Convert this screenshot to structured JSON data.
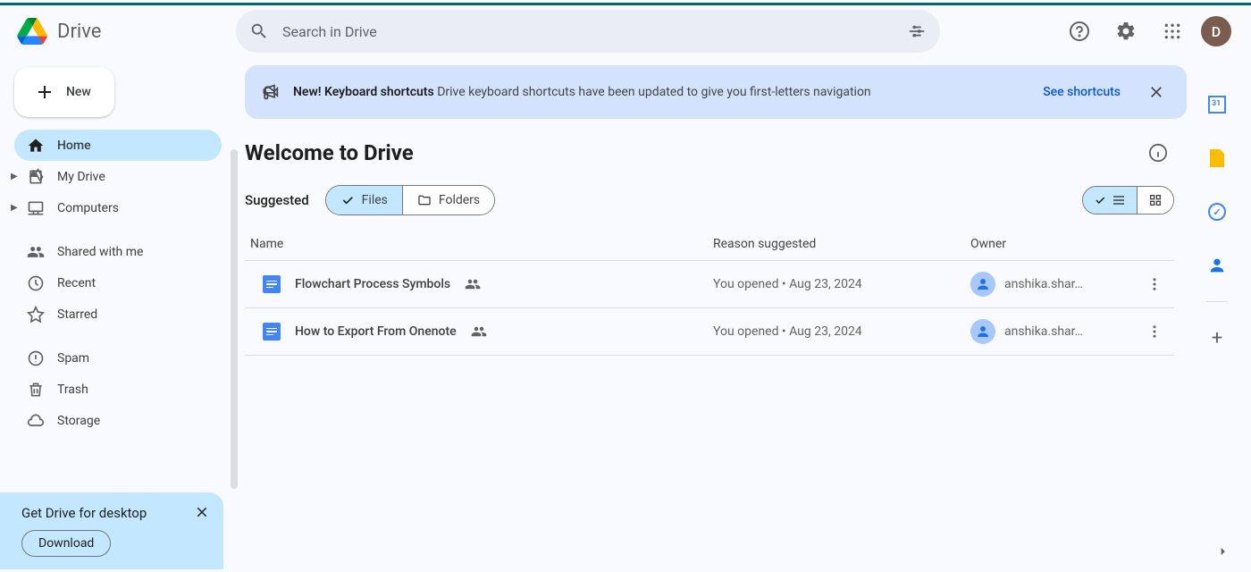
{
  "app": {
    "name": "Drive"
  },
  "search": {
    "placeholder": "Search in Drive"
  },
  "avatar_initial": "D",
  "new_button": "New",
  "sidebar": {
    "items": [
      {
        "label": "Home",
        "active": true
      },
      {
        "label": "My Drive",
        "expandable": true
      },
      {
        "label": "Computers",
        "expandable": true
      },
      {
        "label": "Shared with me"
      },
      {
        "label": "Recent"
      },
      {
        "label": "Starred"
      },
      {
        "label": "Spam"
      },
      {
        "label": "Trash"
      },
      {
        "label": "Storage"
      }
    ]
  },
  "promo": {
    "title": "Get Drive for desktop",
    "button": "Download"
  },
  "banner": {
    "bold": "New! Keyboard shortcuts",
    "text": " Drive keyboard shortcuts have been updated to give you first-letters navigation",
    "link": "See shortcuts"
  },
  "welcome": "Welcome to Drive",
  "suggested_label": "Suggested",
  "filters": {
    "files": "Files",
    "folders": "Folders"
  },
  "columns": {
    "name": "Name",
    "reason": "Reason suggested",
    "owner": "Owner"
  },
  "rows": [
    {
      "name": "Flowchart Process Symbols",
      "reason": "You opened • Aug 23, 2024",
      "owner": "anshika.shar…"
    },
    {
      "name": "How to Export From Onenote",
      "reason": "You opened • Aug 23, 2024",
      "owner": "anshika.shar…"
    }
  ]
}
